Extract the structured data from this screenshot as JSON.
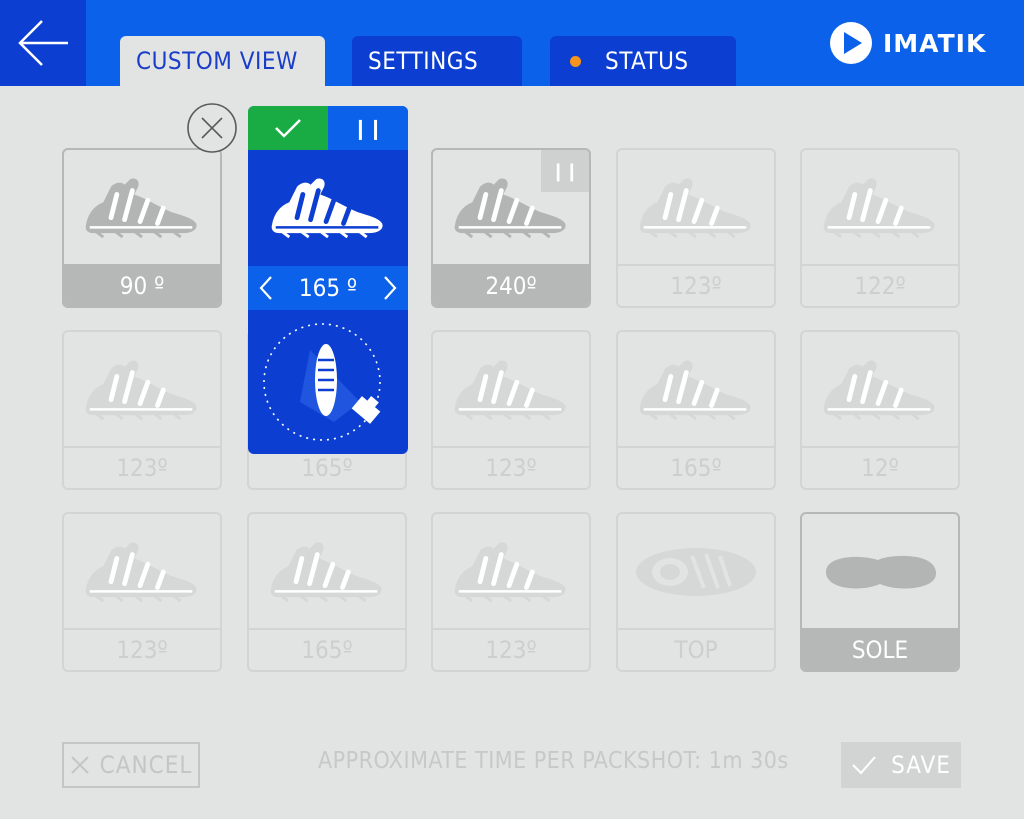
{
  "header": {
    "back_icon": "arrow-left-icon",
    "tabs": [
      {
        "label": "CUSTOM VIEW",
        "active": true
      },
      {
        "label": "SETTINGS",
        "active": false
      },
      {
        "label": "STATUS",
        "active": false,
        "status_dot_color": "#f7941d"
      }
    ],
    "logo_text": "IMATIK"
  },
  "selected": {
    "angle": "165 º",
    "confirm_icon": "checkmark-icon",
    "pause_icon": "pause-icon",
    "prev_icon": "chevron-left-icon",
    "next_icon": "chevron-right-icon",
    "remove_icon": "close-circle-icon"
  },
  "grid": {
    "row1": [
      "90 º",
      "",
      "240º",
      "123º",
      "122º"
    ],
    "row2": [
      "123º",
      "165º",
      "123º",
      "165º",
      "12º"
    ],
    "row3": [
      "123º",
      "165º",
      "123º",
      "TOP",
      "SOLE"
    ]
  },
  "footer": {
    "cancel_label": "CANCEL",
    "approx_text": "APPROXIMATE TIME PER PACKSHOT: 1m 30s",
    "save_label": "SAVE"
  },
  "colors": {
    "primary_blue": "#0b61ea",
    "dark_blue": "#0d3ed2",
    "confirm_green": "#1aac44",
    "status_orange": "#f7941d",
    "background": "#e2e3e3"
  }
}
